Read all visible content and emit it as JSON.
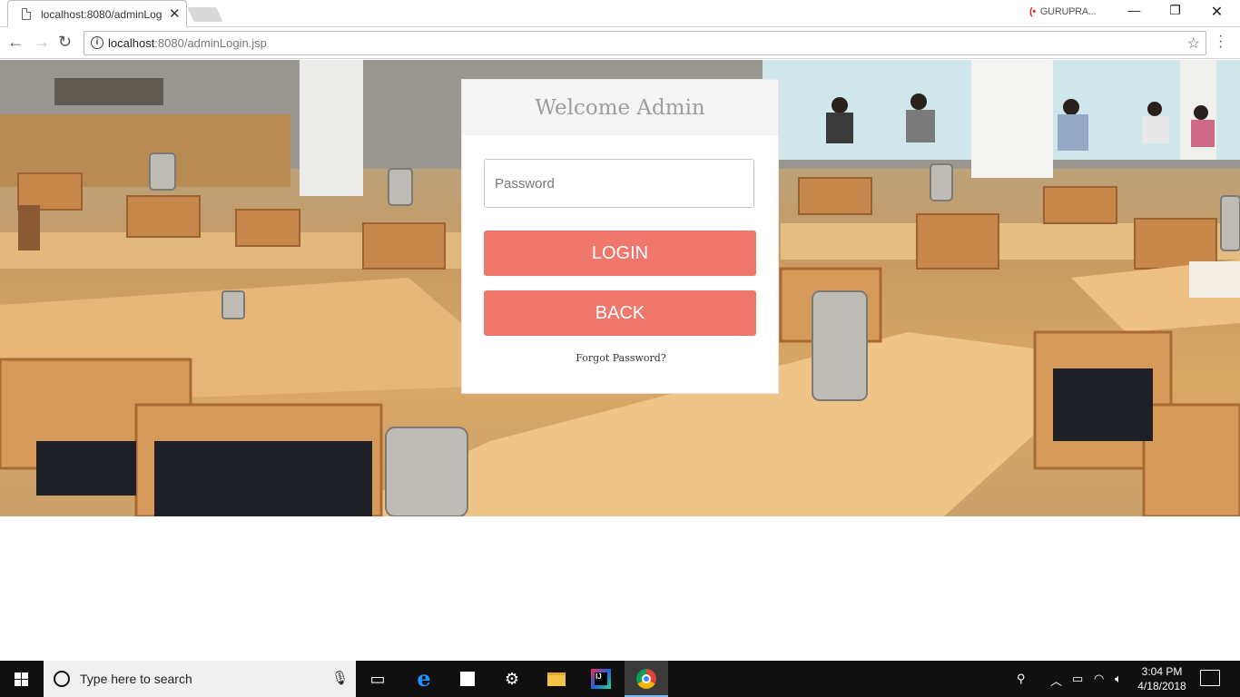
{
  "browser": {
    "tab_title": "localhost:8080/adminLog",
    "tab_close": "✕",
    "profile_name": "GURUPRA...",
    "url_host": "localhost",
    "url_path": ":8080/adminLogin.jsp",
    "window_controls": {
      "minimize": "—",
      "restore": "❐",
      "close": "✕"
    },
    "nav": {
      "back": "←",
      "forward": "→",
      "reload": "↻"
    }
  },
  "login_card": {
    "heading": "Welcome Admin",
    "password_placeholder": "Password",
    "password_value": "",
    "login_label": "LOGIN",
    "back_label": "BACK",
    "forgot_label": "Forgot Password?",
    "accent_color": "#f0776c"
  },
  "taskbar": {
    "search_placeholder": "Type here to search",
    "time": "3:04 PM",
    "date": "4/18/2018",
    "pinned": [
      "task-view-icon",
      "edge-icon",
      "store-icon",
      "settings-icon",
      "file-explorer-icon",
      "intellij-icon",
      "chrome-icon"
    ]
  }
}
